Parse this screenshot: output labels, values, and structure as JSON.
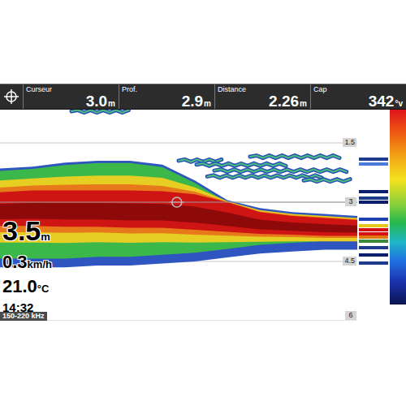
{
  "top_bar": {
    "fields": [
      {
        "label": "Curseur",
        "value": "3.0",
        "unit": "m"
      },
      {
        "label": "Prof.",
        "value": "2.9",
        "unit": "m"
      },
      {
        "label": "Distance",
        "value": "2.26",
        "unit": "m"
      },
      {
        "label": "Cap",
        "value": "342",
        "unit": "°v"
      }
    ]
  },
  "depth_scale": [
    {
      "label": "1.5",
      "depth": 1.5
    },
    {
      "label": "3",
      "depth": 3
    },
    {
      "label": "4.5",
      "depth": 4.5
    },
    {
      "label": "6",
      "depth": 6
    }
  ],
  "readouts": {
    "depth": "3.5",
    "depth_unit": "m",
    "speed": "0.3",
    "speed_unit": "km/h",
    "temperature": "21.0",
    "temperature_unit": "°C",
    "time": "14:32"
  },
  "frequency": "150-220 kHz",
  "cursor": {
    "depth": 3.0,
    "position": 0.495
  },
  "sonar": {
    "max_depth": 6,
    "echo_top": [
      2.15,
      2.1,
      2.0,
      1.95,
      1.95,
      2.05,
      2.45,
      2.95,
      3.15,
      3.25,
      3.3,
      3.35
    ],
    "core_top": [
      2.75,
      2.7,
      2.7,
      2.7,
      2.7,
      2.72,
      2.8,
      3.0,
      3.25,
      3.35,
      3.4,
      3.45
    ],
    "core_bottom": [
      3.6,
      3.6,
      3.62,
      3.62,
      3.65,
      3.65,
      3.7,
      3.75,
      3.8,
      3.82,
      3.85,
      3.85
    ],
    "echo_bottom": [
      4.65,
      4.65,
      4.65,
      4.6,
      4.6,
      4.55,
      4.5,
      4.4,
      4.3,
      4.25,
      4.2,
      4.2
    ],
    "targets": [
      {
        "start": 0.2,
        "end": 0.36,
        "depth": 0.7
      },
      {
        "start": 0.5,
        "end": 0.62,
        "depth": 1.95
      },
      {
        "start": 0.55,
        "end": 0.8,
        "depth": 2.05
      },
      {
        "start": 0.6,
        "end": 0.97,
        "depth": 2.2
      },
      {
        "start": 0.7,
        "end": 0.95,
        "depth": 1.85
      },
      {
        "start": 0.58,
        "end": 0.9,
        "depth": 2.35
      },
      {
        "start": 0.85,
        "end": 0.98,
        "depth": 2.45
      }
    ]
  },
  "flasher": [
    {
      "depth": 1.88,
      "color": "#1e3a8a"
    },
    {
      "depth": 2.0,
      "color": "#4a7bd8"
    },
    {
      "depth": 2.7,
      "color": "#0b1f6e"
    },
    {
      "depth": 2.85,
      "color": "#1e3a8a"
    },
    {
      "depth": 2.95,
      "color": "#0b1f6e"
    },
    {
      "depth": 3.4,
      "color": "#1e40af"
    },
    {
      "depth": 3.55,
      "color": "#e8c81a"
    },
    {
      "depth": 3.65,
      "color": "#d41010"
    },
    {
      "depth": 3.75,
      "color": "#d41010"
    },
    {
      "depth": 3.85,
      "color": "#e07a10"
    },
    {
      "depth": 3.95,
      "color": "#3a8a3a"
    },
    {
      "depth": 4.1,
      "color": "#1e3a8a"
    },
    {
      "depth": 4.3,
      "color": "#0b1f6e"
    },
    {
      "depth": 4.5,
      "color": "#1e3a8a"
    }
  ]
}
